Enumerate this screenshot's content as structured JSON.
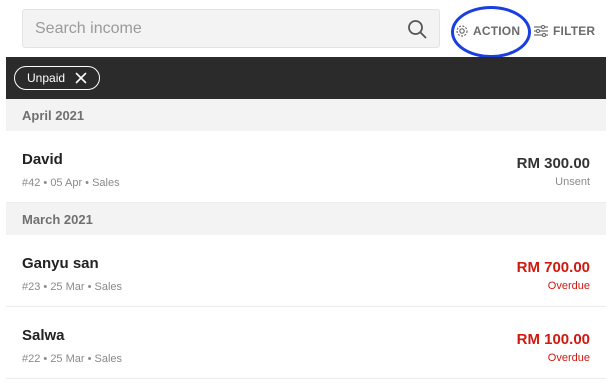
{
  "search": {
    "placeholder": "Search income",
    "value": "",
    "icon": "search-icon"
  },
  "toolbar": {
    "action_label": "ACTION",
    "filter_label": "FILTER",
    "highlight_color": "#1a3ee0"
  },
  "filters": {
    "active_chip": "Unpaid"
  },
  "colors": {
    "overdue": "#d0190f",
    "chipbar": "#2b2b2b"
  },
  "groups": [
    {
      "title": "April 2021",
      "items": [
        {
          "name": "David",
          "meta": "#42 • 05 Apr • Sales",
          "amount": "RM 300.00",
          "status": "Unsent",
          "tone": "normal"
        }
      ]
    },
    {
      "title": "March 2021",
      "items": [
        {
          "name": "Ganyu san",
          "meta": "#23 • 25 Mar • Sales",
          "amount": "RM 700.00",
          "status": "Overdue",
          "tone": "overdue"
        },
        {
          "name": "Salwa",
          "meta": "#22 • 25 Mar • Sales",
          "amount": "RM 100.00",
          "status": "Overdue",
          "tone": "overdue"
        }
      ]
    }
  ]
}
